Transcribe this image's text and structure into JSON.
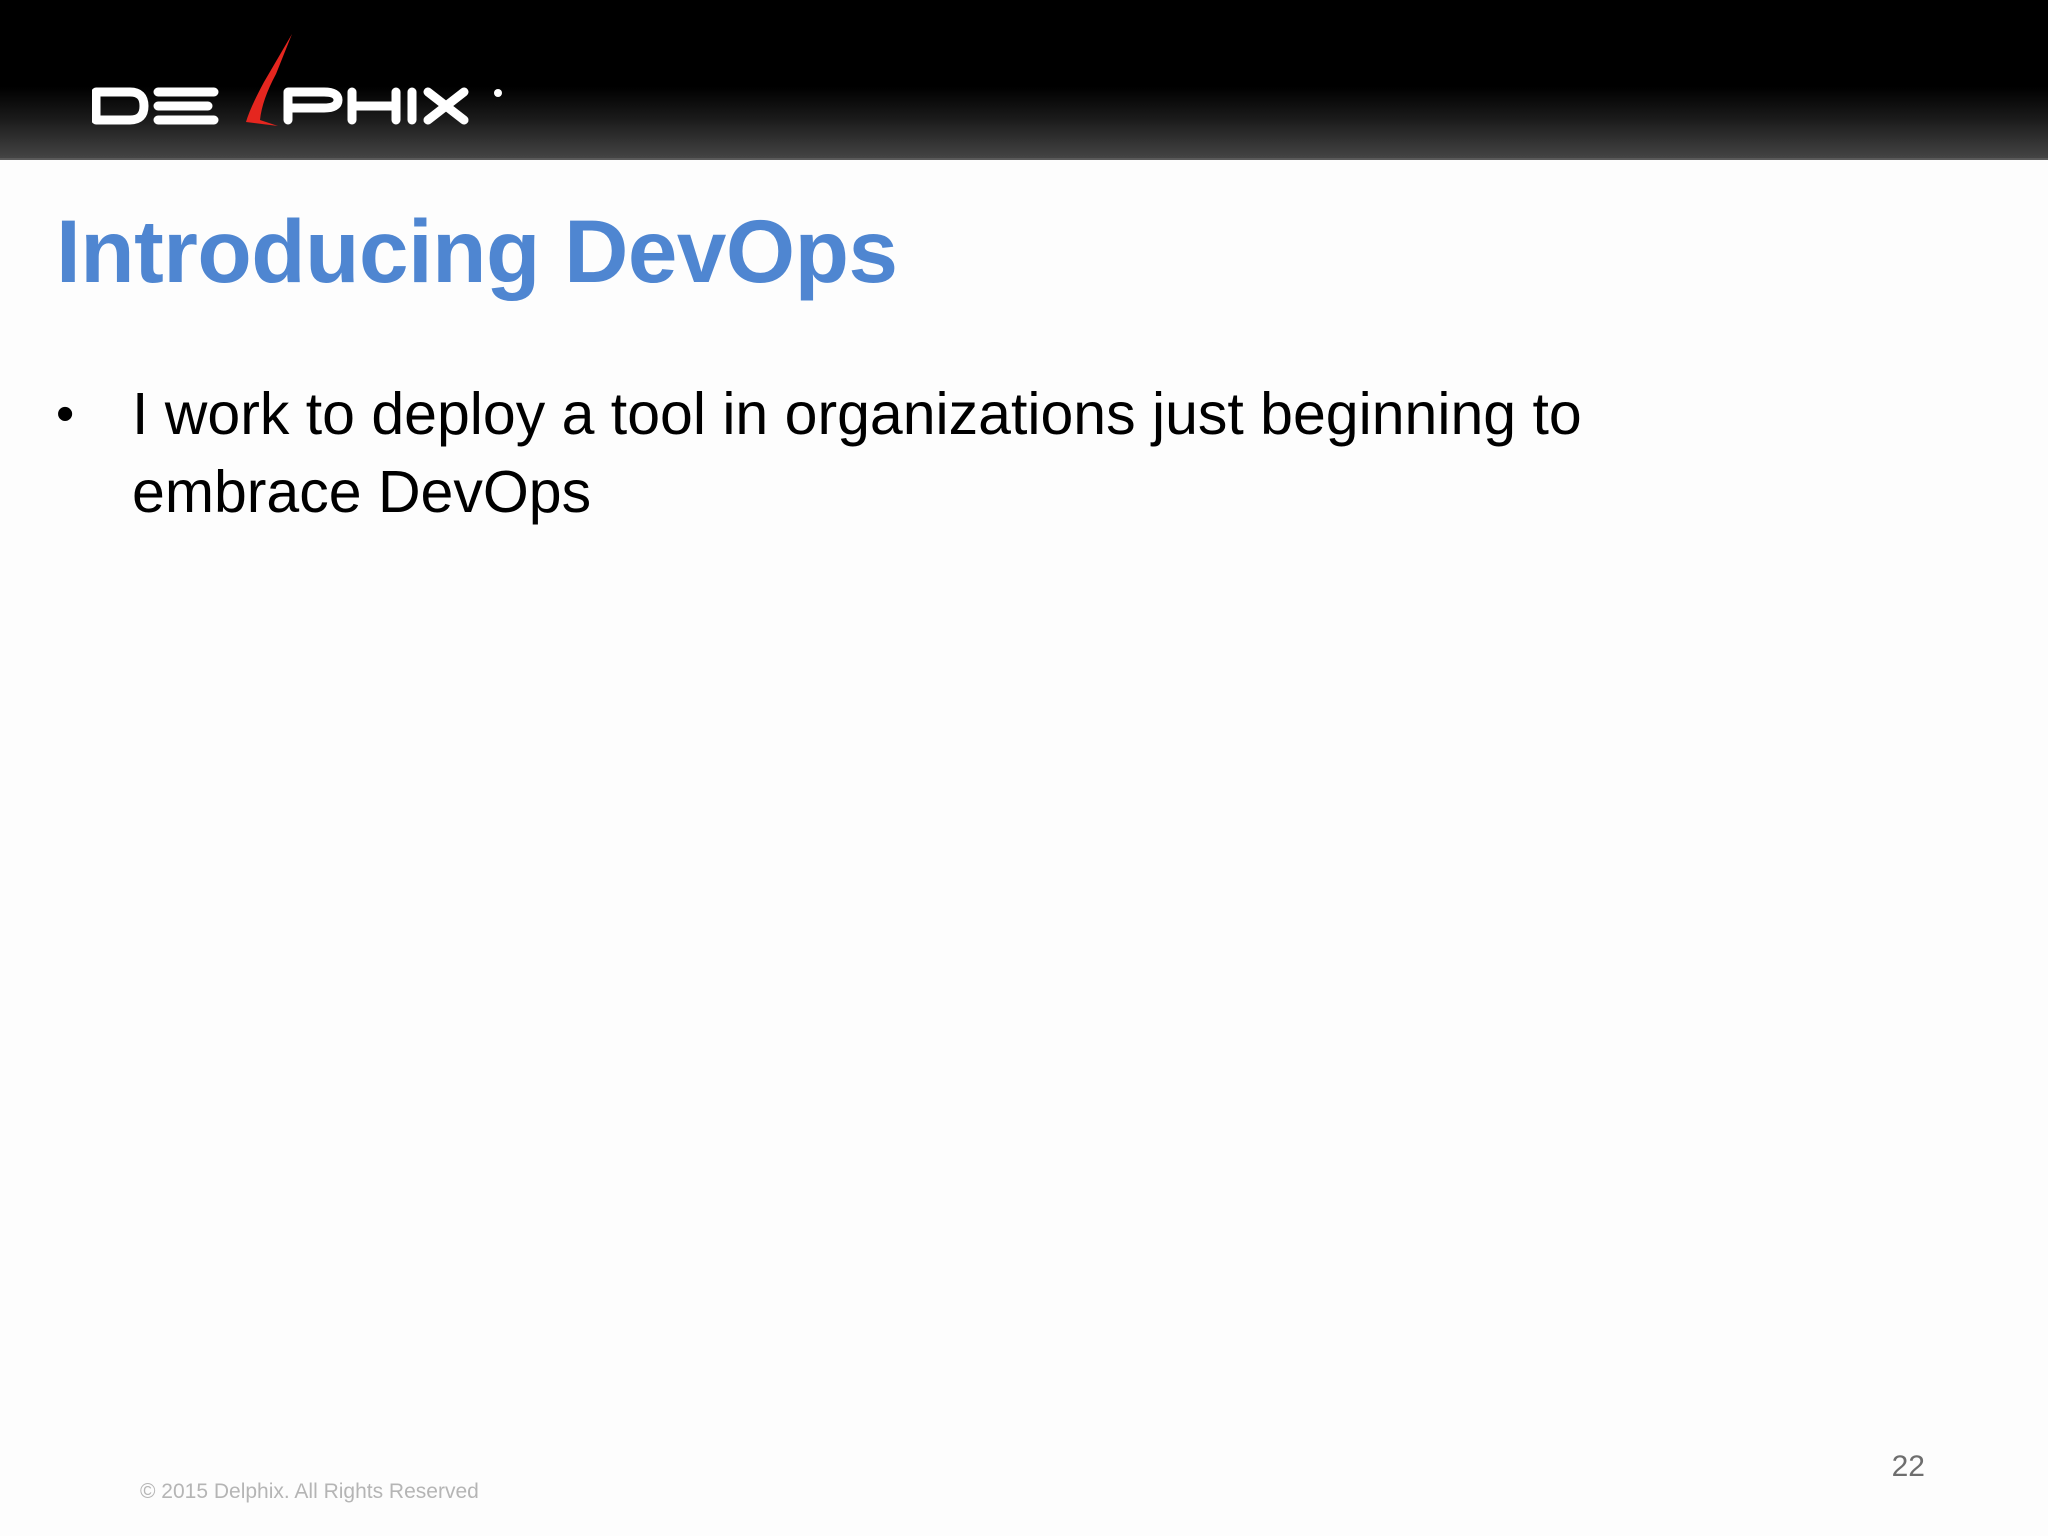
{
  "header": {
    "logo_text": "DELPHIX",
    "logo_icon": "delphix-logo"
  },
  "slide": {
    "title": "Introducing DevOps",
    "bullets": [
      {
        "text": "I work to deploy a tool in organizations just beginning to embrace DevOps"
      }
    ]
  },
  "footer": {
    "copyright": "© 2015 Delphix. All Rights Reserved",
    "page_number": "22"
  },
  "colors": {
    "title": "#4f86d1",
    "header_bar": "#000000",
    "logo_accent": "#e5261f",
    "logo_text": "#ffffff"
  }
}
